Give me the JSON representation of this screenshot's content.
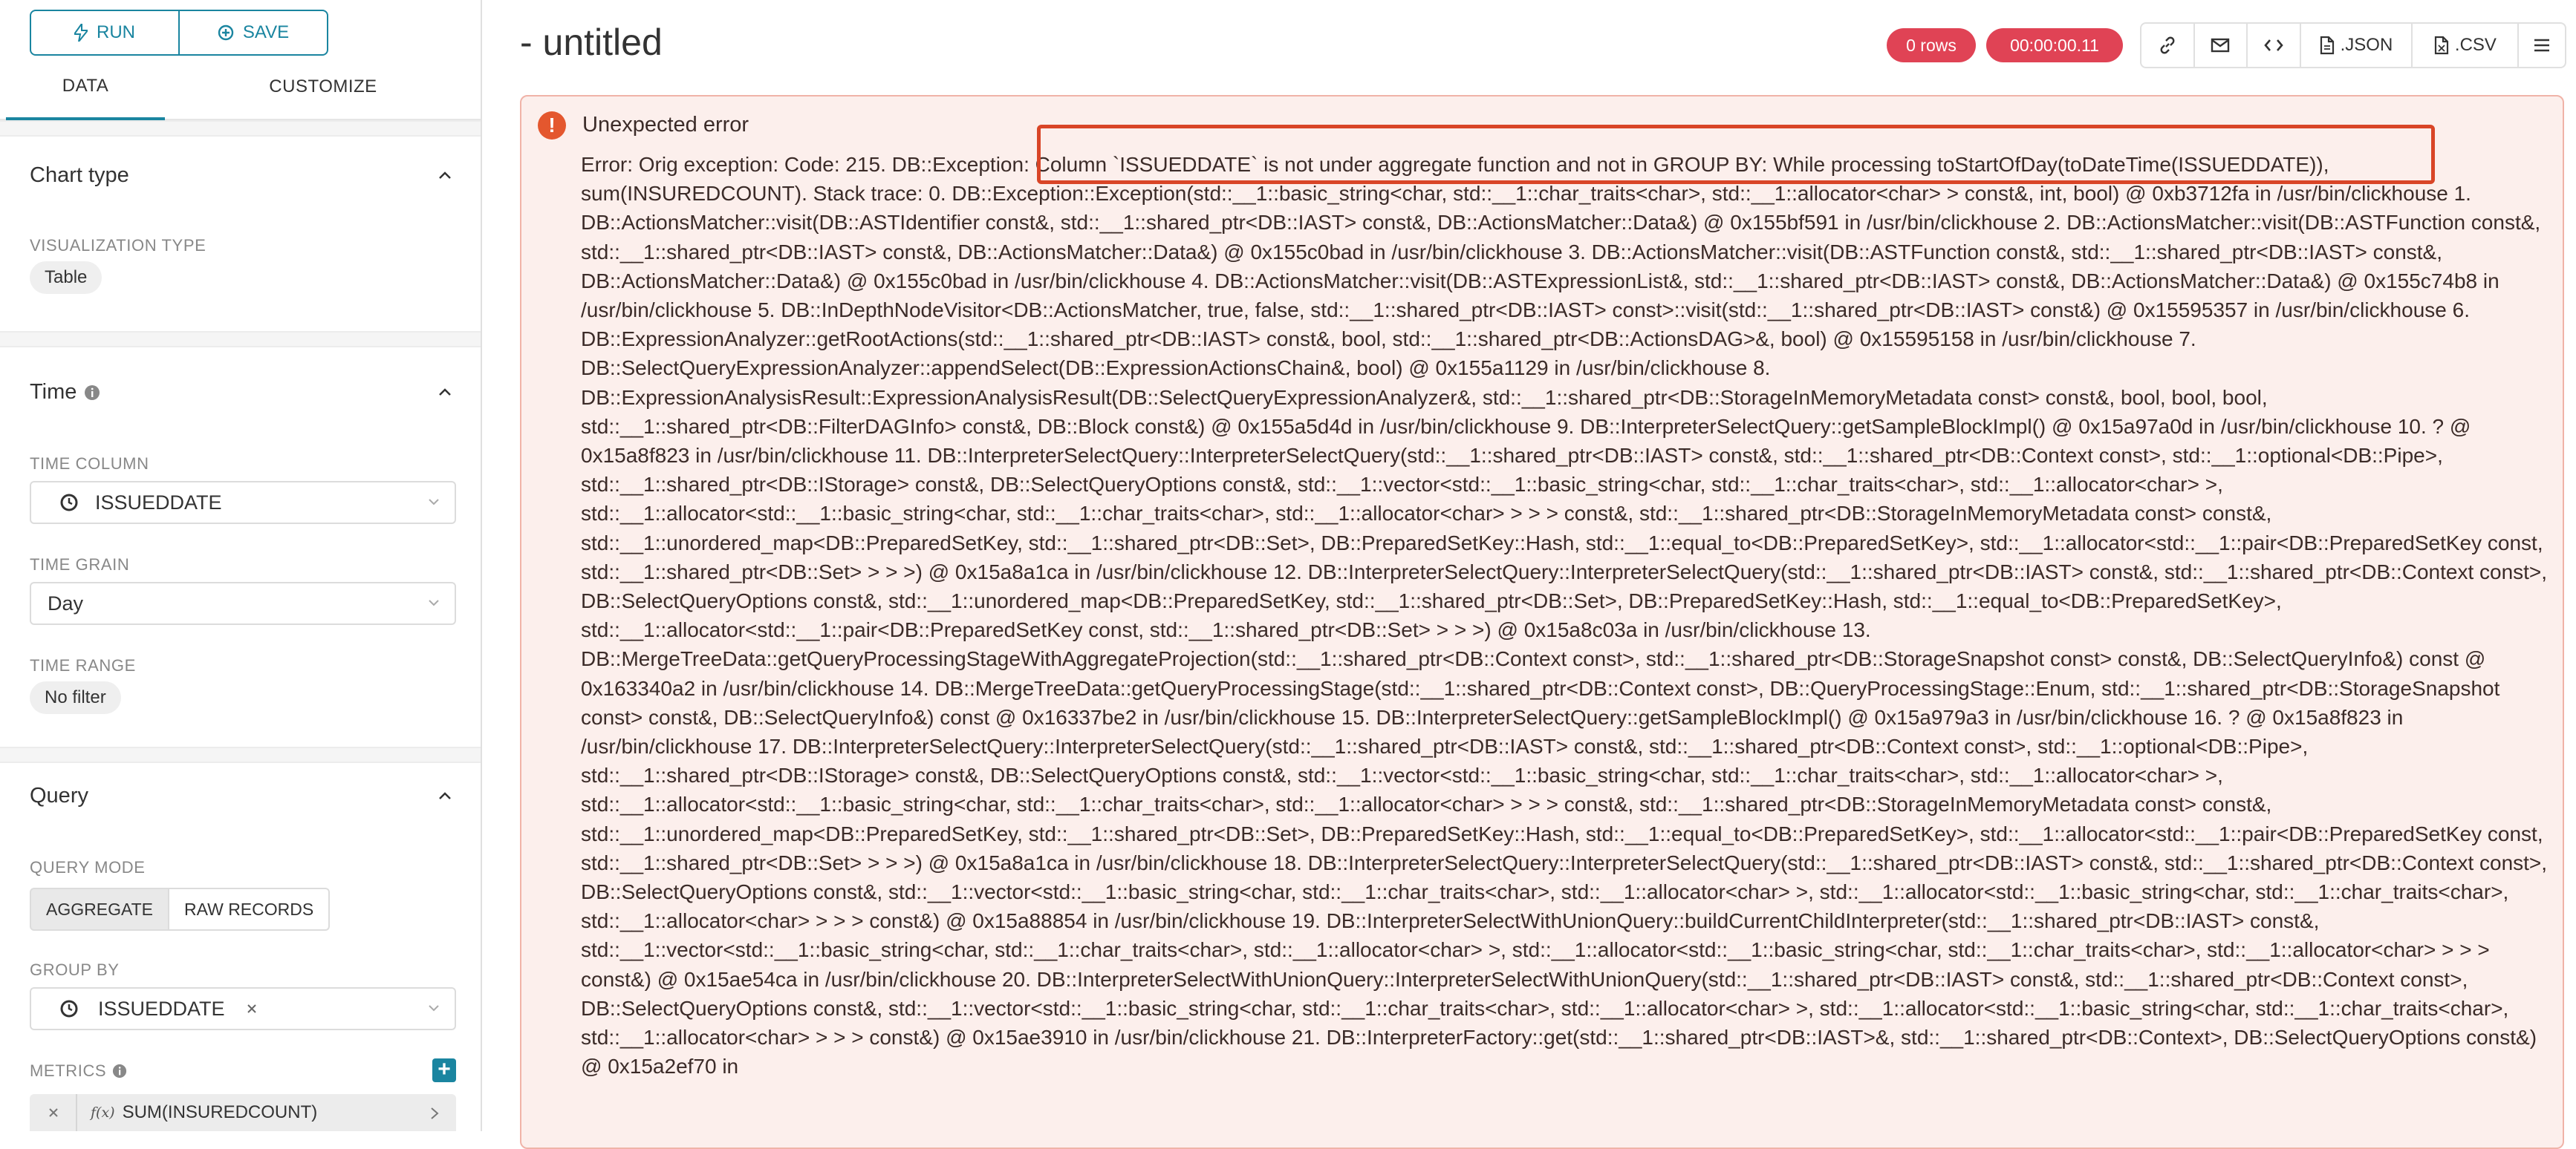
{
  "left": {
    "run_label": "RUN",
    "save_label": "SAVE",
    "tabs": [
      "DATA",
      "CUSTOMIZE"
    ],
    "chart_type": {
      "title": "Chart type",
      "viz_label": "VISUALIZATION TYPE",
      "viz_value": "Table"
    },
    "time": {
      "title": "Time",
      "time_column_label": "TIME COLUMN",
      "time_column_value": "ISSUEDDATE",
      "time_grain_label": "TIME GRAIN",
      "time_grain_value": "Day",
      "time_range_label": "TIME RANGE",
      "time_range_value": "No filter"
    },
    "query": {
      "title": "Query",
      "mode_label": "QUERY MODE",
      "mode_options": [
        "AGGREGATE",
        "RAW RECORDS"
      ],
      "group_by_label": "GROUP BY",
      "group_by_value": "ISSUEDDATE",
      "metrics_label": "METRICS",
      "metric_value": "SUM(INSUREDCOUNT)",
      "metric_fx": "f(x)"
    }
  },
  "header": {
    "title": "- untitled",
    "rows_badge": "0 rows",
    "time_badge": "00:00:00.11",
    "json_label": ".JSON",
    "csv_label": ".CSV"
  },
  "error": {
    "title": "Unexpected error",
    "text": "Error: Orig exception: Code: 215. DB::Exception: Column `ISSUEDDATE` is not under aggregate function and not in GROUP BY: While processing toStartOfDay(toDateTime(ISSUEDDATE)), sum(INSUREDCOUNT). Stack trace: 0. DB::Exception::Exception(std::__1::basic_string<char, std::__1::char_traits<char>, std::__1::allocator<char> > const&, int, bool) @ 0xb3712fa in /usr/bin/clickhouse 1. DB::ActionsMatcher::visit(DB::ASTIdentifier const&, std::__1::shared_ptr<DB::IAST> const&, DB::ActionsMatcher::Data&) @ 0x155bf591 in /usr/bin/clickhouse 2. DB::ActionsMatcher::visit(DB::ASTFunction const&, std::__1::shared_ptr<DB::IAST> const&, DB::ActionsMatcher::Data&) @ 0x155c0bad in /usr/bin/clickhouse 3. DB::ActionsMatcher::visit(DB::ASTFunction const&, std::__1::shared_ptr<DB::IAST> const&, DB::ActionsMatcher::Data&) @ 0x155c0bad in /usr/bin/clickhouse 4. DB::ActionsMatcher::visit(DB::ASTExpressionList&, std::__1::shared_ptr<DB::IAST> const&, DB::ActionsMatcher::Data&) @ 0x155c74b8 in /usr/bin/clickhouse 5. DB::InDepthNodeVisitor<DB::ActionsMatcher, true, false, std::__1::shared_ptr<DB::IAST> const>::visit(std::__1::shared_ptr<DB::IAST> const&) @ 0x15595357 in /usr/bin/clickhouse 6. DB::ExpressionAnalyzer::getRootActions(std::__1::shared_ptr<DB::IAST> const&, bool, std::__1::shared_ptr<DB::ActionsDAG>&, bool) @ 0x15595158 in /usr/bin/clickhouse 7. DB::SelectQueryExpressionAnalyzer::appendSelect(DB::ExpressionActionsChain&, bool) @ 0x155a1129 in /usr/bin/clickhouse 8. DB::ExpressionAnalysisResult::ExpressionAnalysisResult(DB::SelectQueryExpressionAnalyzer&, std::__1::shared_ptr<DB::StorageInMemoryMetadata const> const&, bool, bool, bool, std::__1::shared_ptr<DB::FilterDAGInfo> const&, DB::Block const&) @ 0x155a5d4d in /usr/bin/clickhouse 9. DB::InterpreterSelectQuery::getSampleBlockImpl() @ 0x15a97a0d in /usr/bin/clickhouse 10. ? @ 0x15a8f823 in /usr/bin/clickhouse 11. DB::InterpreterSelectQuery::InterpreterSelectQuery(std::__1::shared_ptr<DB::IAST> const&, std::__1::shared_ptr<DB::Context const>, std::__1::optional<DB::Pipe>, std::__1::shared_ptr<DB::IStorage> const&, DB::SelectQueryOptions const&, std::__1::vector<std::__1::basic_string<char, std::__1::char_traits<char>, std::__1::allocator<char> >, std::__1::allocator<std::__1::basic_string<char, std::__1::char_traits<char>, std::__1::allocator<char> > > > const&, std::__1::shared_ptr<DB::StorageInMemoryMetadata const> const&, std::__1::unordered_map<DB::PreparedSetKey, std::__1::shared_ptr<DB::Set>, DB::PreparedSetKey::Hash, std::__1::equal_to<DB::PreparedSetKey>, std::__1::allocator<std::__1::pair<DB::PreparedSetKey const, std::__1::shared_ptr<DB::Set> > > >) @ 0x15a8a1ca in /usr/bin/clickhouse 12. DB::InterpreterSelectQuery::InterpreterSelectQuery(std::__1::shared_ptr<DB::IAST> const&, std::__1::shared_ptr<DB::Context const>, DB::SelectQueryOptions const&, std::__1::unordered_map<DB::PreparedSetKey, std::__1::shared_ptr<DB::Set>, DB::PreparedSetKey::Hash, std::__1::equal_to<DB::PreparedSetKey>, std::__1::allocator<std::__1::pair<DB::PreparedSetKey const, std::__1::shared_ptr<DB::Set> > > >) @ 0x15a8c03a in /usr/bin/clickhouse 13. DB::MergeTreeData::getQueryProcessingStageWithAggregateProjection(std::__1::shared_ptr<DB::Context const>, std::__1::shared_ptr<DB::StorageSnapshot const> const&, DB::SelectQueryInfo&) const @ 0x163340a2 in /usr/bin/clickhouse 14. DB::MergeTreeData::getQueryProcessingStage(std::__1::shared_ptr<DB::Context const>, DB::QueryProcessingStage::Enum, std::__1::shared_ptr<DB::StorageSnapshot const> const&, DB::SelectQueryInfo&) const @ 0x16337be2 in /usr/bin/clickhouse 15. DB::InterpreterSelectQuery::getSampleBlockImpl() @ 0x15a979a3 in /usr/bin/clickhouse 16. ? @ 0x15a8f823 in /usr/bin/clickhouse 17. DB::InterpreterSelectQuery::InterpreterSelectQuery(std::__1::shared_ptr<DB::IAST> const&, std::__1::shared_ptr<DB::Context const>, std::__1::optional<DB::Pipe>, std::__1::shared_ptr<DB::IStorage> const&, DB::SelectQueryOptions const&, std::__1::vector<std::__1::basic_string<char, std::__1::char_traits<char>, std::__1::allocator<char> >, std::__1::allocator<std::__1::basic_string<char, std::__1::char_traits<char>, std::__1::allocator<char> > > > const&, std::__1::shared_ptr<DB::StorageInMemoryMetadata const> const&, std::__1::unordered_map<DB::PreparedSetKey, std::__1::shared_ptr<DB::Set>, DB::PreparedSetKey::Hash, std::__1::equal_to<DB::PreparedSetKey>, std::__1::allocator<std::__1::pair<DB::PreparedSetKey const, std::__1::shared_ptr<DB::Set> > > >) @ 0x15a8a1ca in /usr/bin/clickhouse 18. DB::InterpreterSelectQuery::InterpreterSelectQuery(std::__1::shared_ptr<DB::IAST> const&, std::__1::shared_ptr<DB::Context const>, DB::SelectQueryOptions const&, std::__1::vector<std::__1::basic_string<char, std::__1::char_traits<char>, std::__1::allocator<char> >, std::__1::allocator<std::__1::basic_string<char, std::__1::char_traits<char>, std::__1::allocator<char> > > > const&) @ 0x15a88854 in /usr/bin/clickhouse 19. DB::InterpreterSelectWithUnionQuery::buildCurrentChildInterpreter(std::__1::shared_ptr<DB::IAST> const&, std::__1::vector<std::__1::basic_string<char, std::__1::char_traits<char>, std::__1::allocator<char> >, std::__1::allocator<std::__1::basic_string<char, std::__1::char_traits<char>, std::__1::allocator<char> > > > const&) @ 0x15ae54ca in /usr/bin/clickhouse 20. DB::InterpreterSelectWithUnionQuery::InterpreterSelectWithUnionQuery(std::__1::shared_ptr<DB::IAST> const&, std::__1::shared_ptr<DB::Context const>, DB::SelectQueryOptions const&, std::__1::vector<std::__1::basic_string<char, std::__1::char_traits<char>, std::__1::allocator<char> >, std::__1::allocator<std::__1::basic_string<char, std::__1::char_traits<char>, std::__1::allocator<char> > > > const&) @ 0x15ae3910 in /usr/bin/clickhouse 21. DB::InterpreterFactory::get(std::__1::shared_ptr<DB::IAST>&, std::__1::shared_ptr<DB::Context>, DB::SelectQueryOptions const&) @ 0x15a2ef70 in"
  },
  "colors": {
    "accent": "#1a85a0",
    "badge": "#e04355",
    "error_bg": "#fcefec",
    "error_border": "#f0b3a8",
    "highlight": "#d94527"
  },
  "icons": [
    "bolt-icon",
    "plus-circle-icon",
    "chevron-up-icon",
    "info-icon",
    "clock-icon",
    "chevron-down-icon",
    "close-icon",
    "plus-icon",
    "link-icon",
    "mail-icon",
    "code-icon",
    "file-icon",
    "menu-icon",
    "error-icon"
  ]
}
